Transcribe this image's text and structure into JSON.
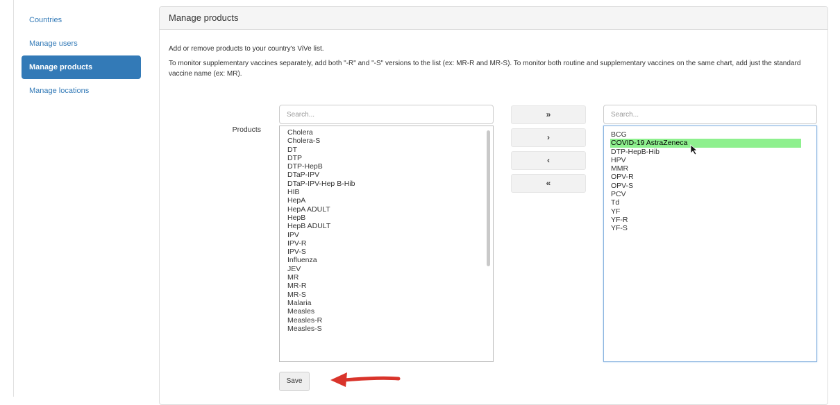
{
  "sidebar": {
    "items": [
      {
        "label": "Countries",
        "active": false
      },
      {
        "label": "Manage users",
        "active": false
      },
      {
        "label": "Manage products",
        "active": true
      },
      {
        "label": "Manage locations",
        "active": false
      }
    ]
  },
  "panel": {
    "title": "Manage products",
    "description_1": "Add or remove products to your country's ViVe list.",
    "description_2": "To monitor supplementary vaccines separately, add both \"-R\" and \"-S\" versions to the list (ex: MR-R and MR-S). To monitor both routine and supplementary vaccines on the same chart, add just the standard vaccine name (ex: MR)."
  },
  "picker": {
    "label": "Products",
    "available_search_placeholder": "Search...",
    "selected_search_placeholder": "Search...",
    "available": [
      "Cholera",
      "Cholera-S",
      "DT",
      "DTP",
      "DTP-HepB",
      "DTaP-IPV",
      "DTaP-IPV-Hep B-Hib",
      "HIB",
      "HepA",
      "HepA ADULT",
      "HepB",
      "HepB ADULT",
      "IPV",
      "IPV-R",
      "IPV-S",
      "Influenza",
      "JEV",
      "MR",
      "MR-R",
      "MR-S",
      "Malaria",
      "Measles",
      "Measles-R",
      "Measles-S"
    ],
    "selected": [
      "BCG",
      "COVID-19 AstraZeneca",
      "DTP-HepB-Hib",
      "HPV",
      "MMR",
      "OPV-R",
      "OPV-S",
      "PCV",
      "Td",
      "YF",
      "YF-R",
      "YF-S"
    ],
    "highlighted": "COVID-19 AstraZeneca",
    "buttons": {
      "move_all_right": "»",
      "move_right": "›",
      "move_left": "‹",
      "move_all_left": "«"
    }
  },
  "save_label": "Save",
  "colors": {
    "accent": "#337ab7",
    "highlight": "#8ef08e",
    "annotation_arrow": "#d9342b"
  }
}
